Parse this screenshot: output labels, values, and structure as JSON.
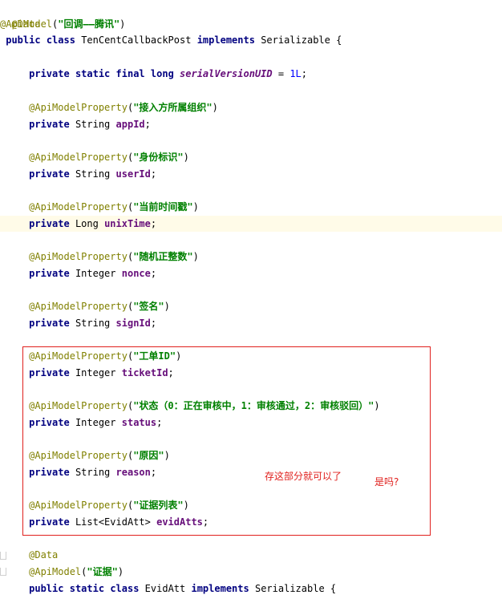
{
  "code": {
    "ann_data": "@Data",
    "ann_apimodel": "@ApiModel",
    "ann_prop": "@ApiModelProperty",
    "class_desc": "\"回调——腾讯\"",
    "class_kw1": "public",
    "class_kw2": "class",
    "class_name": "TenCentCallbackPost",
    "implements": "implements",
    "serializable": "Serializable",
    "brace_open": "{",
    "kw_private": "private",
    "kw_static": "static",
    "kw_final": "final",
    "kw_long": "long",
    "uid_name": "serialVersionUID",
    "uid_eq": "=",
    "uid_val": "1L",
    "semi": ";",
    "fields": [
      {
        "desc": "\"接入方所属组织\"",
        "type": "String",
        "name": "appId"
      },
      {
        "desc": "\"身份标识\"",
        "type": "String",
        "name": "userId"
      },
      {
        "desc": "\"当前时间戳\"",
        "type": "Long",
        "name": "unixTime"
      },
      {
        "desc": "\"随机正整数\"",
        "type": "Integer",
        "name": "nonce"
      },
      {
        "desc": "\"签名\"",
        "type": "String",
        "name": "signId"
      },
      {
        "desc": "\"工单ID\"",
        "type": "Integer",
        "name": "ticketId"
      },
      {
        "desc": "\"状态（0：正在审核中，1：审核通过，2：审核驳回）\"",
        "type": "Integer",
        "name": "status"
      },
      {
        "desc": "\"原因\"",
        "type": "String",
        "name": "reason"
      },
      {
        "desc": "\"证据列表\"",
        "type": "List<EvidAtt>",
        "name": "evidAtts"
      }
    ],
    "inner_desc": "\"证据\"",
    "inner_name": "EvidAtt"
  },
  "annotations": {
    "note1": "存这部分就可以了",
    "note2": "是吗?"
  },
  "colors": {
    "highlight_box": "#e0201d",
    "keyword": "#000080",
    "annotation": "#808000",
    "string": "#008000",
    "field": "#660e7a"
  }
}
